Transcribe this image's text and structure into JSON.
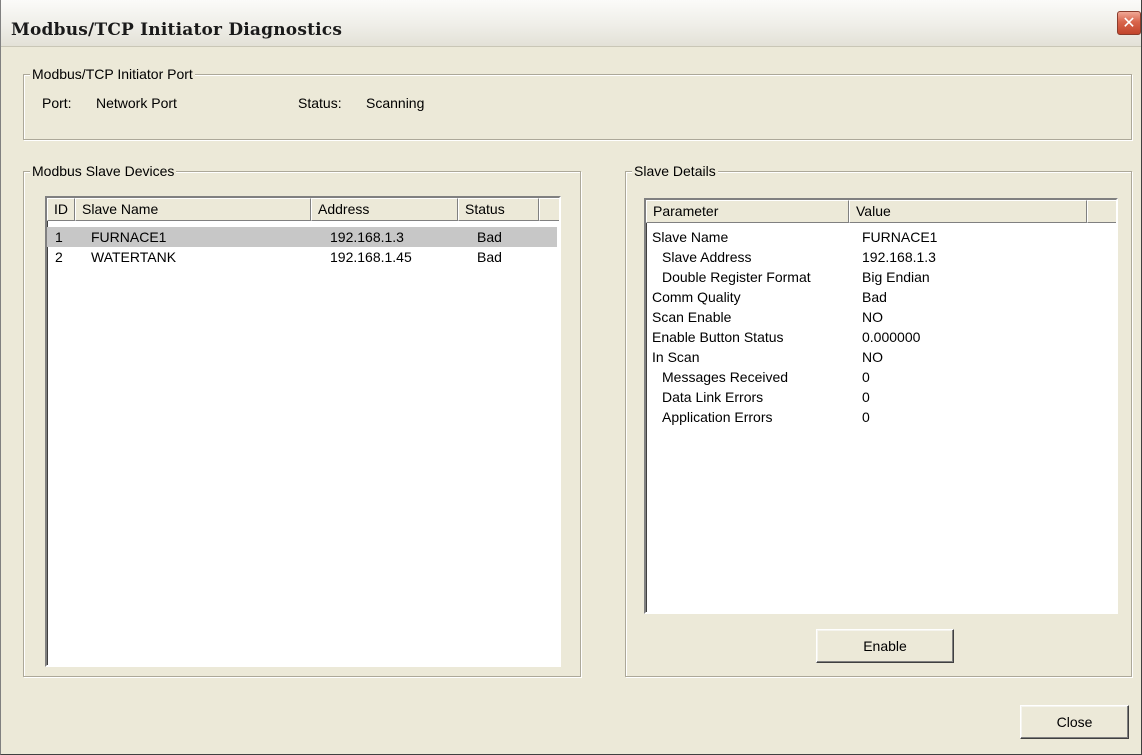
{
  "window": {
    "title": "Modbus/TCP Initiator Diagnostics",
    "close_glyph": "✕"
  },
  "port_group": {
    "legend": "Modbus/TCP Initiator Port",
    "port_label": "Port:",
    "port_value": "Network Port",
    "status_label": "Status:",
    "status_value": "Scanning"
  },
  "devices_group": {
    "legend": "Modbus Slave Devices",
    "columns": [
      "ID",
      "Slave Name",
      "Address",
      "Status"
    ],
    "rows": [
      {
        "id": "1",
        "name": "FURNACE1",
        "address": "192.168.1.3",
        "status": "Bad",
        "selected": true
      },
      {
        "id": "2",
        "name": "WATERTANK",
        "address": "192.168.1.45",
        "status": "Bad",
        "selected": false
      }
    ]
  },
  "details_group": {
    "legend": "Slave Details",
    "columns": [
      "Parameter",
      "Value"
    ],
    "rows": [
      {
        "parameter": "Slave Name",
        "value": "FURNACE1",
        "indent": 0
      },
      {
        "parameter": "Slave Address",
        "value": "192.168.1.3",
        "indent": 1
      },
      {
        "parameter": "Double Register Format",
        "value": "Big Endian",
        "indent": 1
      },
      {
        "parameter": "Comm Quality",
        "value": "Bad",
        "indent": 0
      },
      {
        "parameter": "Scan Enable",
        "value": "NO",
        "indent": 0
      },
      {
        "parameter": "Enable Button Status",
        "value": "0.000000",
        "indent": 0
      },
      {
        "parameter": "In Scan",
        "value": "NO",
        "indent": 0
      },
      {
        "parameter": "Messages Received",
        "value": "0",
        "indent": 1
      },
      {
        "parameter": "Data Link Errors",
        "value": "0",
        "indent": 1
      },
      {
        "parameter": "Application Errors",
        "value": "0",
        "indent": 1
      }
    ],
    "enable_button": "Enable"
  },
  "footer": {
    "close_button": "Close"
  },
  "colors": {
    "dialog_bg": "#ece9d8",
    "selected_row": "#c7c7c7",
    "close_button_red": "#c2452c"
  }
}
